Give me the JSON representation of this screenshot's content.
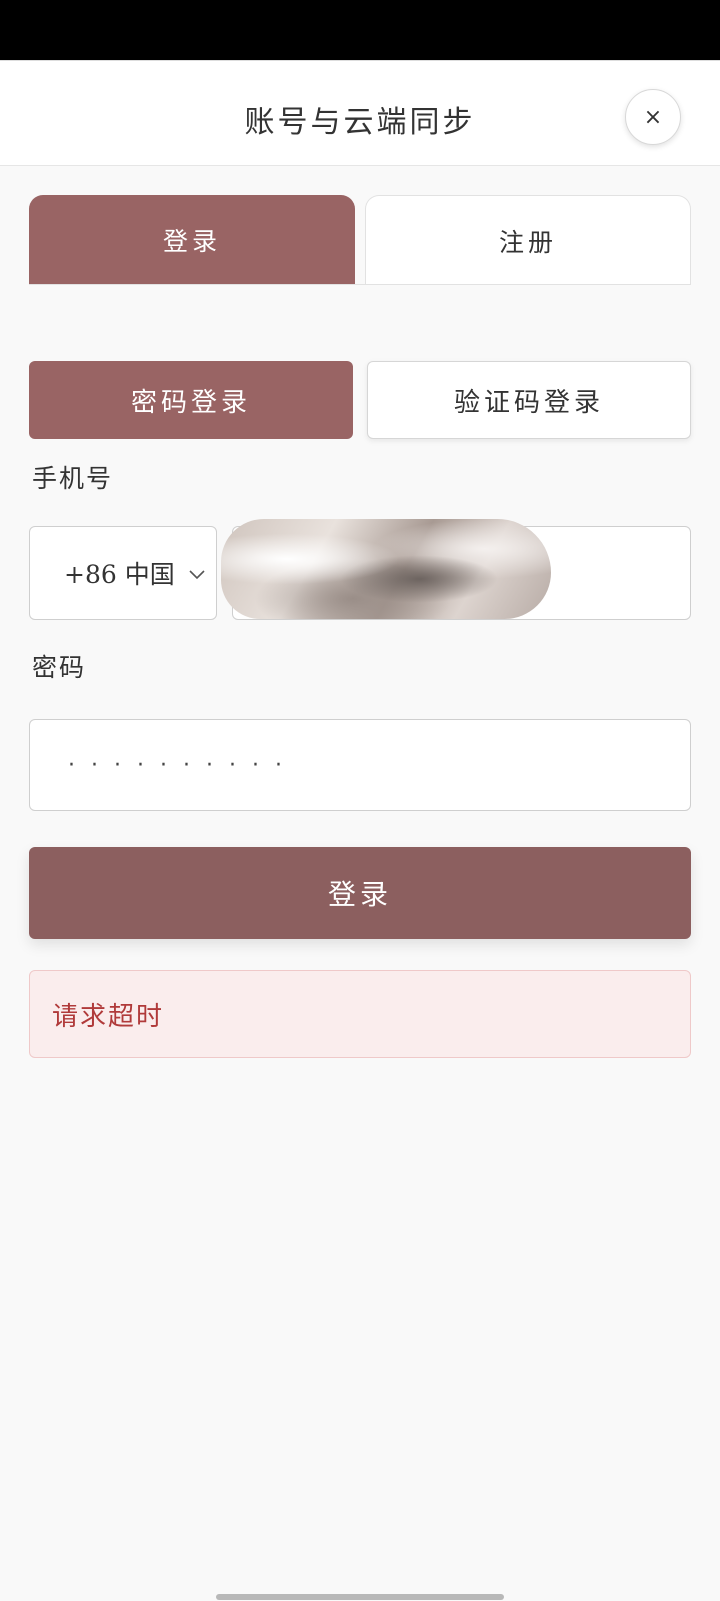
{
  "header": {
    "title": "账号与云端同步",
    "close_label": "×"
  },
  "tabs": [
    {
      "label": "登录",
      "active": true
    },
    {
      "label": "注册",
      "active": false
    }
  ],
  "login_modes": [
    {
      "label": "密码登录",
      "active": true
    },
    {
      "label": "验证码登录",
      "active": false
    }
  ],
  "phone": {
    "label": "手机号",
    "country_code": "+86 中国",
    "value_redacted": true
  },
  "password": {
    "label": "密码",
    "masked_value": "··········"
  },
  "login_button": {
    "label": "登录"
  },
  "error": {
    "message": "请求超时"
  },
  "colors": {
    "accent": "#996464",
    "button": "#8c5f5f",
    "error_text": "#b03a3a",
    "error_bg": "#faeded"
  }
}
